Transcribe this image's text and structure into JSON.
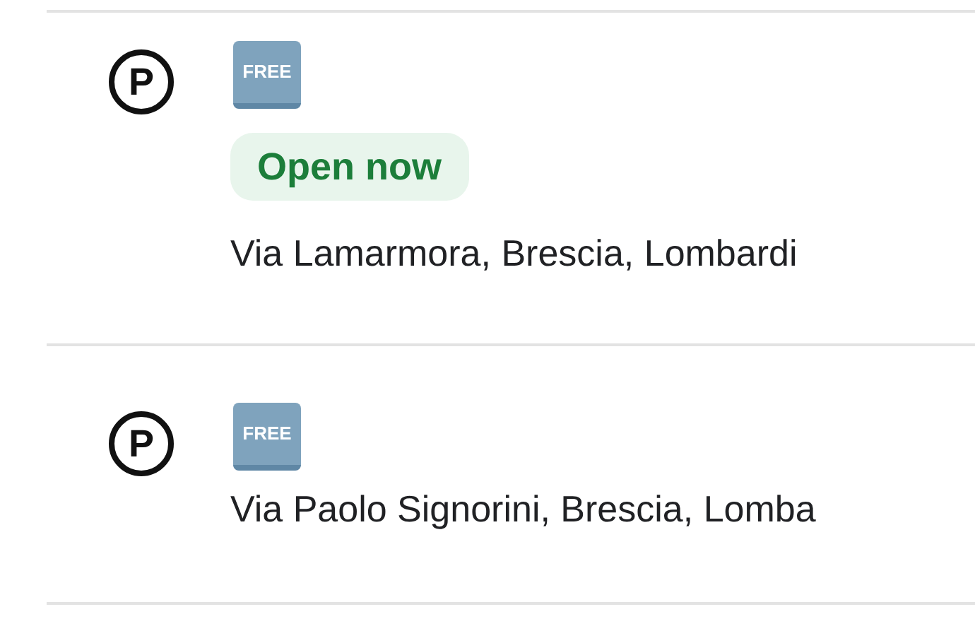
{
  "places": [
    {
      "icon": "P",
      "badge": "FREE",
      "status": "Open now",
      "address": "Via Lamarmora, Brescia, Lombardi"
    },
    {
      "icon": "P",
      "badge": "FREE",
      "address": "Via Paolo Signorini, Brescia, Lomba"
    }
  ]
}
